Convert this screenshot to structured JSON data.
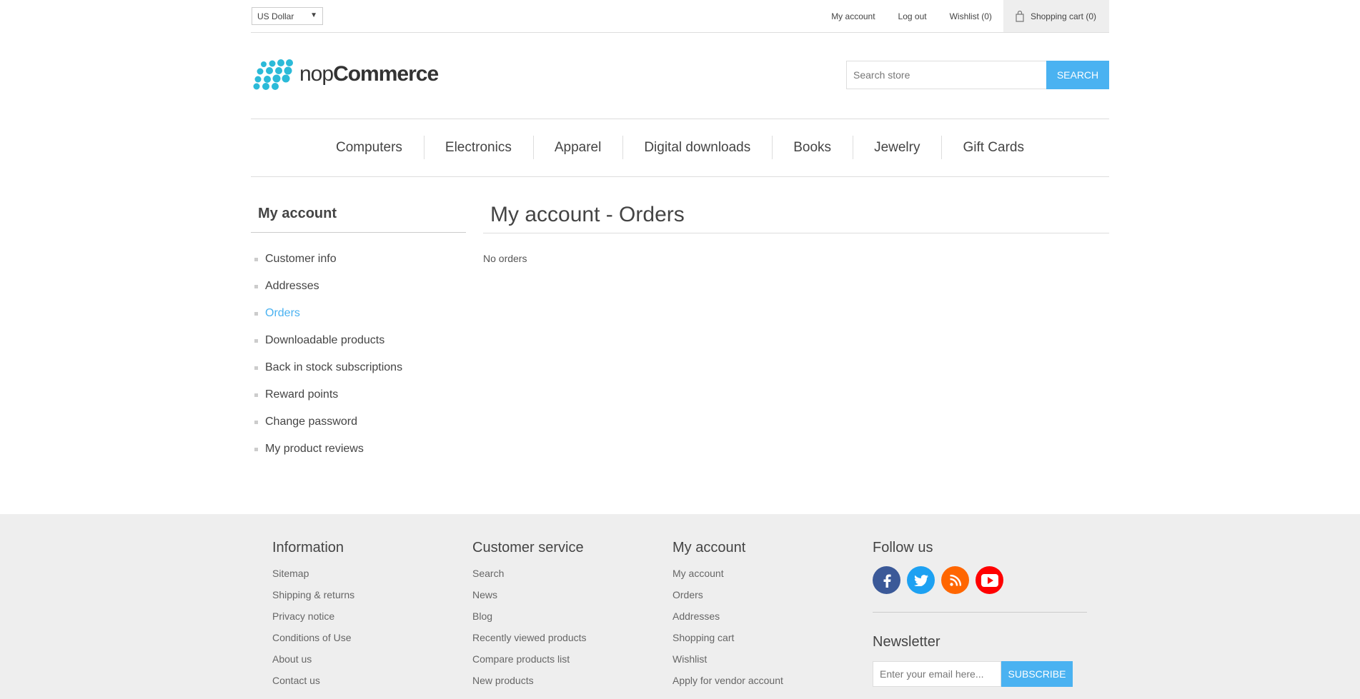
{
  "header": {
    "currency": "US Dollar",
    "links": [
      "My account",
      "Log out",
      "Wishlist (0)"
    ],
    "cart": "Shopping cart (0)"
  },
  "logo": {
    "part1": "nop",
    "part2": "Commerce"
  },
  "search": {
    "placeholder": "Search store",
    "button": "SEARCH"
  },
  "menu": [
    "Computers",
    "Electronics",
    "Apparel",
    "Digital downloads",
    "Books",
    "Jewelry",
    "Gift Cards"
  ],
  "side": {
    "title": "My account",
    "items": [
      "Customer info",
      "Addresses",
      "Orders",
      "Downloadable products",
      "Back in stock subscriptions",
      "Reward points",
      "Change password",
      "My product reviews"
    ],
    "active": "Orders"
  },
  "main": {
    "title": "My account - Orders",
    "empty": "No orders"
  },
  "footer": {
    "information": {
      "title": "Information",
      "links": [
        "Sitemap",
        "Shipping & returns",
        "Privacy notice",
        "Conditions of Use",
        "About us",
        "Contact us"
      ]
    },
    "customer_service": {
      "title": "Customer service",
      "links": [
        "Search",
        "News",
        "Blog",
        "Recently viewed products",
        "Compare products list",
        "New products"
      ]
    },
    "my_account": {
      "title": "My account",
      "links": [
        "My account",
        "Orders",
        "Addresses",
        "Shopping cart",
        "Wishlist",
        "Apply for vendor account"
      ]
    },
    "follow": {
      "title": "Follow us",
      "icons": [
        "facebook-icon",
        "twitter-icon",
        "rss-icon",
        "youtube-icon"
      ],
      "colors": [
        "#3b5998",
        "#1da1f2",
        "#ff6600",
        "#ff0000"
      ]
    },
    "newsletter": {
      "title": "Newsletter",
      "placeholder": "Enter your email here...",
      "button": "SUBSCRIBE"
    }
  },
  "colors": {
    "accent": "#4ab2f1"
  }
}
